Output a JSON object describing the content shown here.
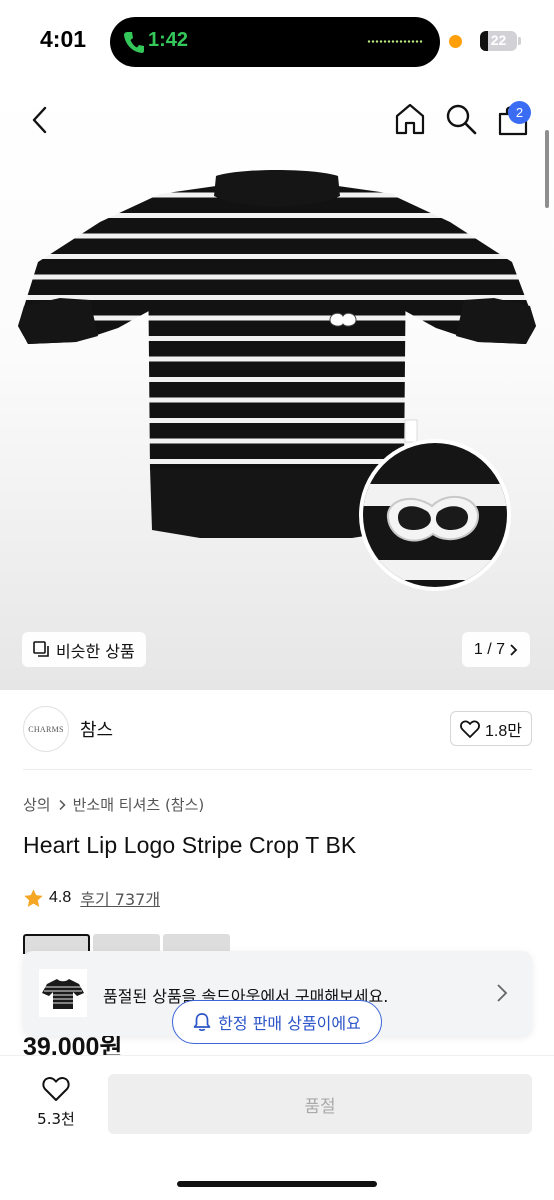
{
  "status_bar": {
    "time": "4:01",
    "call_timer": "1:42",
    "battery": "22",
    "battery_level": 0.22,
    "call_color": "#34c759",
    "recording_dot_color": "#ff9f0a"
  },
  "nav": {
    "back_icon": "chevron-left-icon",
    "home_icon": "home-icon",
    "search_icon": "search-icon",
    "cart_icon": "shopping-bag-icon",
    "cart_badge": "2",
    "badge_color": "#3b6cf4"
  },
  "gallery": {
    "similar_label": "비슷한 상품",
    "page_indicator": "1 / 7"
  },
  "brand": {
    "logo_text": "CHARMS",
    "name": "참스",
    "like_count": "1.8만"
  },
  "product": {
    "breadcrumb": [
      "상의",
      "반소매 티셔츠 (참스)"
    ],
    "title": "Heart Lip Logo Stripe Crop T BK",
    "rating": "4.8",
    "reviews": "후기 737개",
    "price": "39,000원",
    "star_color": "#f5a623"
  },
  "banner": {
    "text": "품절된 상품을 솔드아웃에서 구매해보세요.",
    "limited_label": "한정 판매 상품이에요",
    "accent_color": "#3d66d8"
  },
  "bottom": {
    "wish_count": "5.3천",
    "soldout_label": "품절"
  }
}
